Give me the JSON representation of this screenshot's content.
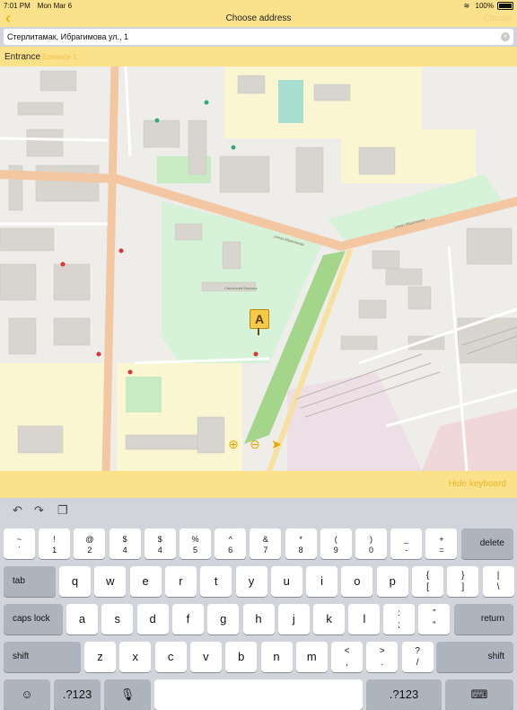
{
  "status_bar": {
    "time": "7:01 PM",
    "date": "Mon Mar 6",
    "battery": "100%"
  },
  "nav": {
    "back_icon": "chevron-left-icon",
    "title": "Choose address",
    "choose_label": "Choose"
  },
  "address_input": {
    "value": "Стерлитамак, Ибрагимова ул., 1"
  },
  "entrance": {
    "label": "Entrance",
    "placeholder": "Entrance 1"
  },
  "map": {
    "marker_label": "A",
    "street_labels": [
      "улица Ибрагимова",
      "улица Ибрагимова"
    ],
    "place_labels": [
      "Санаторий Березка"
    ]
  },
  "map_controls": {
    "zoom_in_icon": "zoom-in-icon",
    "zoom_out_icon": "zoom-out-icon",
    "locate_icon": "location-arrow-icon"
  },
  "keyboard_bar": {
    "hide_keyboard": "Hide keyboard"
  },
  "keyboard": {
    "row1": [
      {
        "top": "~",
        "bot": "`"
      },
      {
        "top": "!",
        "bot": "1"
      },
      {
        "top": "@",
        "bot": "2"
      },
      {
        "top": "$",
        "bot": "4"
      },
      {
        "top": "$",
        "bot": "4"
      },
      {
        "top": "%",
        "bot": "5"
      },
      {
        "top": "^",
        "bot": "6"
      },
      {
        "top": "&",
        "bot": "7"
      },
      {
        "top": "*",
        "bot": "8"
      },
      {
        "top": "(",
        "bot": "9"
      },
      {
        "top": ")",
        "bot": "0"
      },
      {
        "top": "_",
        "bot": "-"
      },
      {
        "top": "+",
        "bot": "="
      }
    ],
    "delete": "delete",
    "tab": "tab",
    "row2": [
      "q",
      "w",
      "e",
      "r",
      "t",
      "y",
      "u",
      "i",
      "o",
      "p"
    ],
    "row2_extra": [
      {
        "top": "{",
        "bot": "["
      },
      {
        "top": "}",
        "bot": "]"
      },
      {
        "top": "|",
        "bot": "\\"
      }
    ],
    "caps_lock": "caps lock",
    "row3": [
      "a",
      "s",
      "d",
      "f",
      "g",
      "h",
      "j",
      "k",
      "l"
    ],
    "row3_extra": [
      {
        "top": ":",
        "bot": ";"
      },
      {
        "top": "”",
        "bot": "“"
      }
    ],
    "return": "return",
    "shift_left": "shift",
    "row4": [
      "z",
      "x",
      "c",
      "v",
      "b",
      "n",
      "m"
    ],
    "row4_extra": [
      {
        "top": "<",
        "bot": ","
      },
      {
        "top": ">",
        "bot": "."
      },
      {
        "top": "?",
        "bot": "/"
      }
    ],
    "shift_right": "shift",
    "emoji_icon": "emoji-icon",
    "numbers_left": ".?123",
    "mic_icon": "mic-icon",
    "numbers_right": ".?123",
    "keyboard_icon": "keyboard-icon"
  }
}
